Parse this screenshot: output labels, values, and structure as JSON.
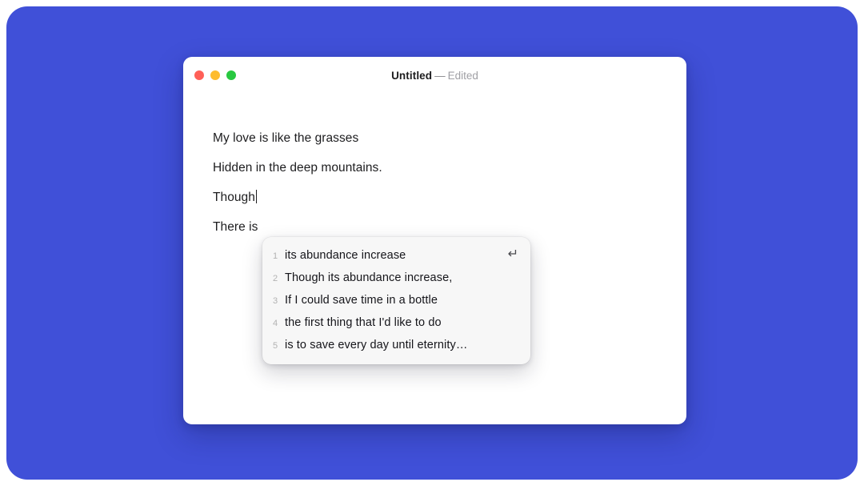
{
  "background": {
    "color": "#4050d8"
  },
  "window": {
    "traffic_lights": [
      {
        "name": "close",
        "color": "#ff5f57"
      },
      {
        "name": "minimize",
        "color": "#febc2e"
      },
      {
        "name": "zoom",
        "color": "#28c840"
      }
    ],
    "title": {
      "name": "Untitled",
      "separator": "—",
      "state": "Edited"
    }
  },
  "document": {
    "lines": [
      "My love is like the grasses",
      "Hidden in the deep mountains.",
      "Though",
      "There is"
    ],
    "caret_after_line_index": 2
  },
  "suggestions": {
    "return_icon": "↵",
    "items": [
      {
        "index": "1",
        "label": "its abundance increase"
      },
      {
        "index": "2",
        "label": "Though its abundance increase,"
      },
      {
        "index": "3",
        "label": "If I could save time in a bottle"
      },
      {
        "index": "4",
        "label": "the first thing that I'd like to do"
      },
      {
        "index": "5",
        "label": "is to save every day until eternity…"
      }
    ]
  }
}
